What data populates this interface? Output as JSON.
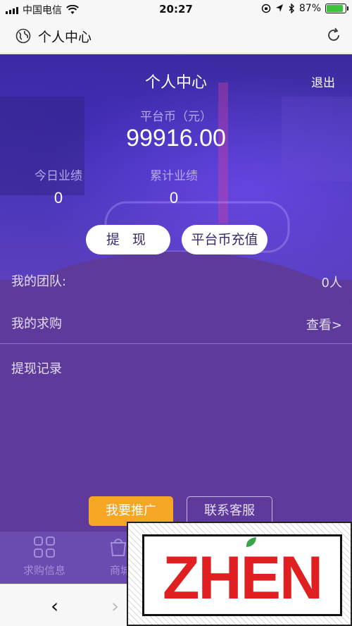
{
  "status_bar": {
    "carrier": "中国电信",
    "time": "20:27",
    "battery": "87%",
    "battery_level": 0.87
  },
  "browser": {
    "title": "个人中心"
  },
  "header": {
    "title": "个人中心",
    "logout": "退出"
  },
  "balance": {
    "label": "平台币（元）",
    "value": "99916.00"
  },
  "stats": {
    "today": {
      "label": "今日业绩",
      "value": "0"
    },
    "total": {
      "label": "累计业绩",
      "value": "0"
    }
  },
  "actions": {
    "withdraw": "提 现",
    "recharge": "平台币充值"
  },
  "rows": {
    "team": {
      "label": "我的团队:",
      "value": "0人"
    },
    "purchase": {
      "label": "我的求购",
      "value": "查看>"
    },
    "records": {
      "label": "提现记录"
    }
  },
  "buttons": {
    "promote": "我要推广",
    "contact": "联系客服"
  },
  "tabs": [
    {
      "label": "求购信息"
    },
    {
      "label": "商城"
    }
  ],
  "nav": {
    "back": "‹",
    "forward": "›"
  },
  "watermark": {
    "text": "ZHEN"
  },
  "colors": {
    "accent": "#5e3b9a",
    "promo": "#f5a623",
    "watermark": "#e02020"
  }
}
